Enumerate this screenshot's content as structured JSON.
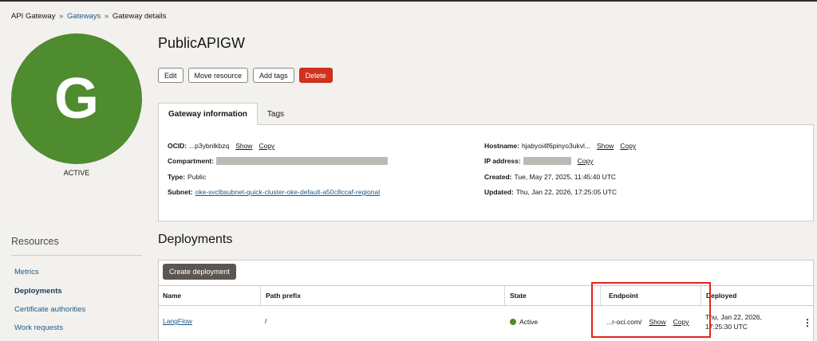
{
  "breadcrumb": {
    "root": "API Gateway",
    "gateways": "Gateways",
    "current": "Gateway details",
    "sep": "»"
  },
  "gateway": {
    "avatar_letter": "G",
    "status": "ACTIVE",
    "title": "PublicAPIGW"
  },
  "actions": {
    "edit": "Edit",
    "move": "Move resource",
    "tags": "Add tags",
    "delete": "Delete"
  },
  "tabs": {
    "info": "Gateway information",
    "tags": "Tags"
  },
  "info": {
    "ocid_label": "OCID:",
    "ocid_value": "...p3ybnlkbzq",
    "show": "Show",
    "copy": "Copy",
    "compartment_label": "Compartment:",
    "type_label": "Type:",
    "type_value": "Public",
    "subnet_label": "Subnet:",
    "subnet_value": "oke-svclbsubnet-quick-cluster-oke-default-a50c8ccaf-regional",
    "hostname_label": "Hostname:",
    "hostname_value": "hjabyoi4f6pinyo3ukvl...",
    "ip_label": "IP address:",
    "created_label": "Created:",
    "created_value": "Tue, May 27, 2025, 11:45:40 UTC",
    "updated_label": "Updated:",
    "updated_value": "Thu, Jan 22, 2026, 17:25:05 UTC"
  },
  "resources": {
    "title": "Resources",
    "items": [
      "Metrics",
      "Deployments",
      "Certificate authorities",
      "Work requests"
    ]
  },
  "deployments": {
    "title": "Deployments",
    "create": "Create deployment",
    "columns": [
      "Name",
      "Path prefix",
      "State",
      "Endpoint",
      "Deployed"
    ],
    "rows": [
      {
        "name": "LangFlow",
        "path": "/",
        "state": "Active",
        "endpoint": "...r-oci.com/",
        "show": "Show",
        "copy": "Copy",
        "deployed_1": "Thu, Jan 22, 2026,",
        "deployed_2": "17:25:30 UTC"
      }
    ]
  },
  "colors": {
    "accent": "#4f8b2f",
    "danger": "#d0321f",
    "link": "#1a5a8a",
    "highlight": "#e2261b"
  }
}
